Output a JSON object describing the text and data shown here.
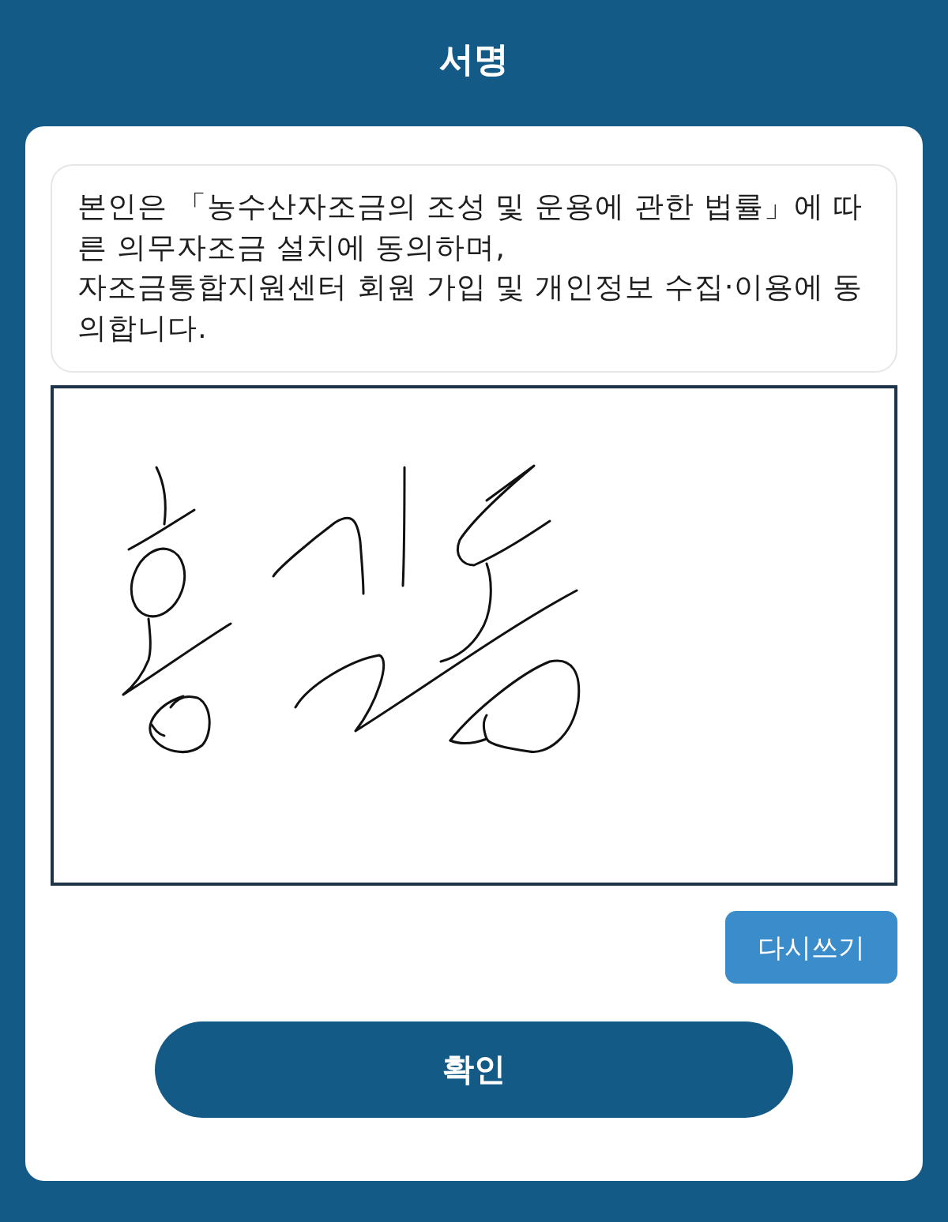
{
  "header": {
    "title": "서명"
  },
  "consent": {
    "text": "본인은 「농수산자조금의 조성 및 운용에 관한 법률」에 따른 의무자조금 설치에 동의하며,\n자조금통합지원센터 회원 가입 및 개인정보 수집·이용에 동의합니다."
  },
  "signature_pad": {
    "signed": true
  },
  "reset_button": {
    "label": "다시쓰기"
  },
  "confirm_button": {
    "label": "확인"
  }
}
